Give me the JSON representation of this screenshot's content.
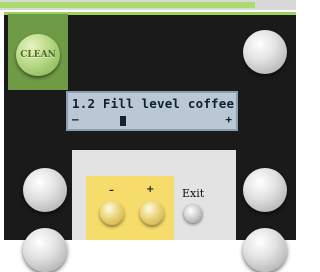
{
  "clean_button": {
    "label": "CLEAN"
  },
  "display": {
    "text": "1.2 Fill level coffee",
    "minus_symbol": "–",
    "plus_symbol": "+"
  },
  "controls": {
    "minus_label": "–",
    "plus_label": "+",
    "exit_label": "Exit"
  },
  "colors": {
    "accent_green": "#a9dc6c",
    "panel": "#1a1a1a",
    "display_bg": "#b9c8d4",
    "control_yellow": "#f5dc6b"
  }
}
